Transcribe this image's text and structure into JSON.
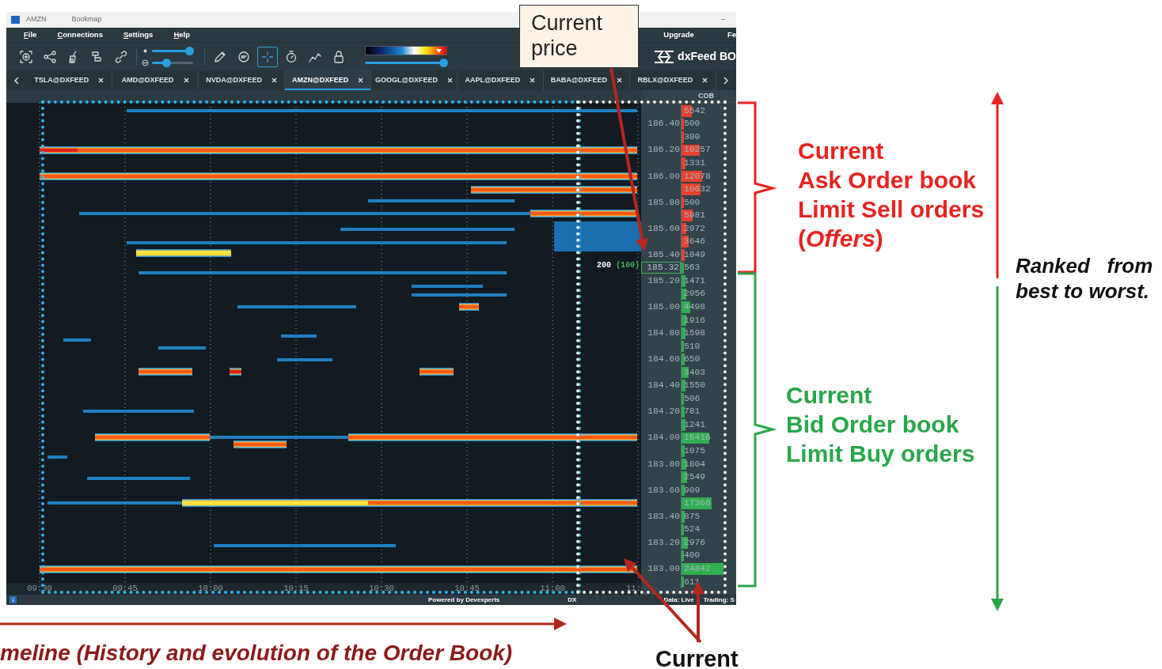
{
  "window": {
    "app_label": "AMZN",
    "title": "Bookmap",
    "minimize": "–"
  },
  "menu": [
    {
      "label": "File"
    },
    {
      "label": "Connections"
    },
    {
      "label": "Settings"
    },
    {
      "label": "Help"
    }
  ],
  "menu_right": [
    "Upgrade",
    "Fe"
  ],
  "toolbar": {
    "tools_left": [
      {
        "kind": "focus",
        "selected": false
      },
      {
        "kind": "share",
        "selected": false
      },
      {
        "kind": "broom",
        "selected": false
      },
      {
        "kind": "layers",
        "selected": false
      },
      {
        "kind": "link",
        "selected": false
      }
    ],
    "brightness_sliders": [
      {
        "level": 0.9
      },
      {
        "level": 0.35
      }
    ],
    "tools_right": [
      {
        "kind": "pencil",
        "selected": false
      },
      {
        "kind": "chat",
        "selected": false
      },
      {
        "kind": "crosshair",
        "selected": true
      },
      {
        "kind": "timer",
        "selected": false
      },
      {
        "kind": "chart",
        "selected": false
      },
      {
        "kind": "lock",
        "selected": false
      }
    ],
    "heatmap_scale": {
      "level": 0.95
    },
    "brand": "dxFeed BO"
  },
  "tabs": [
    {
      "label": "TSLA@DXFEED",
      "selected": false
    },
    {
      "label": "AMD@DXFEED",
      "selected": false
    },
    {
      "label": "NVDA@DXFEED",
      "selected": false
    },
    {
      "label": "AMZN@DXFEED",
      "selected": true
    },
    {
      "label": "GOOGL@DXFEED",
      "selected": false
    },
    {
      "label": "AAPL@DXFEED",
      "selected": false
    },
    {
      "label": "BABA@DXFEED",
      "selected": false
    },
    {
      "label": "RBLX@DXFEED",
      "selected": false
    }
  ],
  "ladder": {
    "header": "COB",
    "rows": [
      {
        "size": "5542",
        "kind": "ask",
        "current": false,
        "level": 0.21
      },
      {
        "price": "186.40",
        "size": "500",
        "kind": "ask",
        "current": false,
        "level": 0.02
      },
      {
        "size": "300",
        "kind": "ask",
        "current": false,
        "level": 0.01
      },
      {
        "price": "186.20",
        "size": "10257",
        "kind": "ask",
        "current": false,
        "level": 0.39
      },
      {
        "size": "1331",
        "kind": "ask",
        "current": false,
        "level": 0.05
      },
      {
        "price": "186.00",
        "size": "12078",
        "kind": "ask",
        "current": false,
        "level": 0.46
      },
      {
        "size": "10632",
        "kind": "ask",
        "current": false,
        "level": 0.41
      },
      {
        "price": "185.80",
        "size": "500",
        "kind": "ask",
        "current": false,
        "level": 0.02
      },
      {
        "size": "5981",
        "kind": "ask",
        "current": false,
        "level": 0.23
      },
      {
        "price": "185.60",
        "size": "2072",
        "kind": "ask",
        "current": false,
        "level": 0.08
      },
      {
        "size": "3646",
        "kind": "ask",
        "current": false,
        "level": 0.14
      },
      {
        "price": "185.40",
        "size": "1049",
        "kind": "ask",
        "current": false,
        "level": 0.04
      },
      {
        "price": "185.32",
        "size": "563",
        "kind": "bid",
        "current": true,
        "level": 0.02
      },
      {
        "price": "185.20",
        "size": "1471",
        "kind": "bid",
        "current": false,
        "level": 0.06
      },
      {
        "size": "2056",
        "kind": "bid",
        "current": false,
        "level": 0.08
      },
      {
        "price": "185.00",
        "size": "4498",
        "kind": "bid",
        "current": false,
        "level": 0.17
      },
      {
        "size": "1916",
        "kind": "bid",
        "current": false,
        "level": 0.07
      },
      {
        "price": "184.80",
        "size": "1598",
        "kind": "bid",
        "current": false,
        "level": 0.06
      },
      {
        "size": "510",
        "kind": "bid",
        "current": false,
        "level": 0.02
      },
      {
        "price": "184.60",
        "size": "650",
        "kind": "bid",
        "current": false,
        "level": 0.03
      },
      {
        "size": "3403",
        "kind": "bid",
        "current": false,
        "level": 0.13
      },
      {
        "price": "184.40",
        "size": "1550",
        "kind": "bid",
        "current": false,
        "level": 0.06
      },
      {
        "size": "506",
        "kind": "bid",
        "current": false,
        "level": 0.02
      },
      {
        "price": "184.20",
        "size": "781",
        "kind": "bid",
        "current": false,
        "level": 0.03
      },
      {
        "size": "1241",
        "kind": "bid",
        "current": false,
        "level": 0.05
      },
      {
        "price": "184.00",
        "size": "16416",
        "kind": "bid",
        "current": false,
        "level": 0.63
      },
      {
        "size": "1075",
        "kind": "bid",
        "current": false,
        "level": 0.04
      },
      {
        "price": "183.80",
        "size": "1804",
        "kind": "bid",
        "current": false,
        "level": 0.07
      },
      {
        "size": "2549",
        "kind": "bid",
        "current": false,
        "level": 0.1
      },
      {
        "price": "183.60",
        "size": "909",
        "kind": "bid",
        "current": false,
        "level": 0.03
      },
      {
        "size": "17366",
        "kind": "bid",
        "current": false,
        "level": 0.67
      },
      {
        "price": "183.40",
        "size": "875",
        "kind": "bid",
        "current": false,
        "level": 0.03
      },
      {
        "size": "524",
        "kind": "bid",
        "current": false,
        "level": 0.02
      },
      {
        "price": "183.20",
        "size": "2976",
        "kind": "bid",
        "current": false,
        "level": 0.11
      },
      {
        "size": "400",
        "kind": "bid",
        "current": false,
        "level": 0.02
      },
      {
        "price": "183.00",
        "size": "24842",
        "kind": "bid",
        "current": false,
        "level": 0.96
      },
      {
        "size": "611",
        "kind": "bid",
        "current": false,
        "level": 0.02
      }
    ]
  },
  "last_trade": {
    "size": "200",
    "volume": "(100)"
  },
  "time_axis": [
    "09:30",
    "09:45",
    "10:00",
    "10:15",
    "10:30",
    "10:45",
    "11:00",
    "11:"
  ],
  "status_bar": {
    "powered_by": "Powered by Devexperts",
    "feed": "DX",
    "data": "Data: Live",
    "trading": "Trading: S"
  },
  "annotations": {
    "price_callout": "Current price",
    "ask_label": [
      "Current",
      "Ask Order book",
      "Limit Sell orders",
      "(*Offers*)"
    ],
    "bid_label": [
      "Current",
      "Bid Order book",
      "Limit Buy orders"
    ],
    "ranked_label": [
      "Ranked   from",
      "best to worst."
    ],
    "timeline_label": "meline (History and evolution of the Order Book)",
    "current_label": "Current"
  }
}
